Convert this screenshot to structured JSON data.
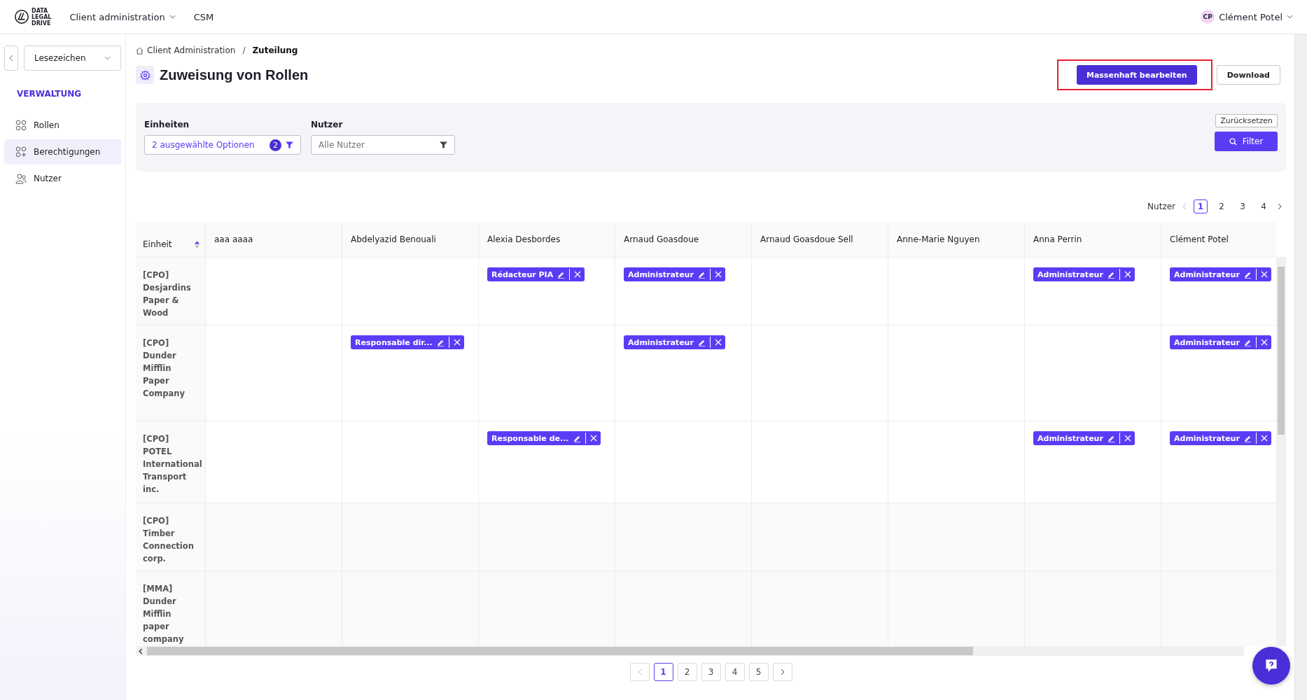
{
  "topbar": {
    "logo_lines": [
      "DATA",
      "LEGAL",
      "DRIVE"
    ],
    "menu": [
      {
        "label": "Client administration",
        "dropdown": true
      },
      {
        "label": "CSM",
        "dropdown": false
      }
    ],
    "user": {
      "initials": "CP",
      "name": "Clément Potel"
    }
  },
  "sidebar": {
    "bookmark": "Lesezeichen",
    "section": "VERWALTUNG",
    "items": [
      {
        "label": "Rollen",
        "selected": false
      },
      {
        "label": "Berechtigungen",
        "selected": true
      },
      {
        "label": "Nutzer",
        "selected": false
      }
    ]
  },
  "breadcrumb": {
    "items": [
      "Client Administration",
      "Zuteilung"
    ],
    "separator": "/"
  },
  "title": "Zuweisung von Rollen",
  "actions": [
    {
      "label": "Massenhaft bearbeiten",
      "kind": "primary",
      "highlighted": true
    },
    {
      "label": "Download",
      "kind": "secondary",
      "highlighted": false
    }
  ],
  "filters": {
    "units": {
      "label": "Einheiten",
      "value": "2 ausgewählte Optionen",
      "count": "2"
    },
    "users": {
      "label": "Nutzer",
      "placeholder": "Alle Nutzer"
    },
    "reset": "Zurücksetzen",
    "apply": "Filter"
  },
  "user_pager": {
    "label": "Nutzer",
    "pages": [
      {
        "label": "1",
        "selected": true
      },
      {
        "label": "2",
        "selected": false
      },
      {
        "label": "3",
        "selected": false
      },
      {
        "label": "4",
        "selected": false
      }
    ]
  },
  "table": {
    "columns": [
      "Einheit",
      "aaa aaaa",
      "Abdelyazid Benouali",
      "Alexia Desbordes",
      "Arnaud Goasdoue",
      "Arnaud Goasdoue Sell",
      "Anne-Marie Nguyen",
      "Anna Perrin",
      "Clément Potel"
    ],
    "rows": [
      {
        "cells": [
          "[CPO] Desjardins Paper & Wood",
          "",
          "",
          "Rédacteur PIA",
          "Administrateur",
          "",
          "",
          "Administrateur",
          "Administrateur"
        ]
      },
      {
        "cells": [
          "[CPO] Dunder Mifflin Paper Company",
          "",
          "Responsable dir...",
          "",
          "Administrateur",
          "",
          "",
          "",
          "Administrateur"
        ]
      },
      {
        "cells": [
          "[CPO] POTEL International Transport inc.",
          "",
          "",
          "Responsable de...",
          "",
          "",
          "",
          "Administrateur",
          "Administrateur"
        ]
      },
      {
        "cells": [
          "[CPO] Timber Connection corp.",
          "",
          "",
          "",
          "",
          "",
          "",
          "",
          ""
        ]
      },
      {
        "cells": [
          "[MMA] Dunder Mifflin paper company",
          "",
          "",
          "",
          "",
          "",
          "",
          "",
          ""
        ]
      }
    ]
  },
  "unit_pager": {
    "pages": [
      {
        "label": "1",
        "selected": true
      },
      {
        "label": "2",
        "selected": false
      },
      {
        "label": "3",
        "selected": false
      },
      {
        "label": "4",
        "selected": false
      },
      {
        "label": "5",
        "selected": false
      }
    ]
  }
}
